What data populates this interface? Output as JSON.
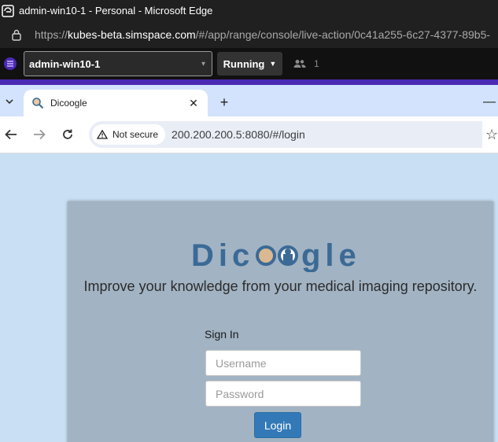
{
  "window": {
    "title": "admin-win10-1 - Personal - Microsoft Edge"
  },
  "outer_address_bar": {
    "scheme": "https://",
    "host": "kubes-beta.simspace.com",
    "path": "/#/app/range/console/live-action/0c41a255-6c27-4377-89b5-"
  },
  "console": {
    "vm_name": "admin-win10-1",
    "status": "Running",
    "user_count": "1"
  },
  "inner_browser": {
    "tab_title": "Dicoogle",
    "security_label": "Not secure",
    "url": "200.200.200.5:8080/#/login"
  },
  "page": {
    "brand_text": "Dicoogle",
    "tagline": "Improve your knowledge from your medical imaging repository.",
    "signin_label": "Sign In",
    "username_placeholder": "Username",
    "password_placeholder": "Password",
    "login_label": "Login"
  },
  "colors": {
    "accent": "#4b2ab3",
    "login_button": "#3379b7",
    "brand": "#3b6a96",
    "card": "#a2b3c3",
    "page_background": "#c9dff3"
  },
  "icons": [
    "edge-app-icon",
    "lock-icon",
    "simspace-logo-icon",
    "chevron-down-icon",
    "users-icon",
    "tab-list-icon",
    "magnifier-favicon",
    "close-icon",
    "plus-icon",
    "minimize-icon",
    "back-arrow-icon",
    "forward-arrow-icon",
    "reload-icon",
    "warning-icon",
    "star-icon"
  ]
}
